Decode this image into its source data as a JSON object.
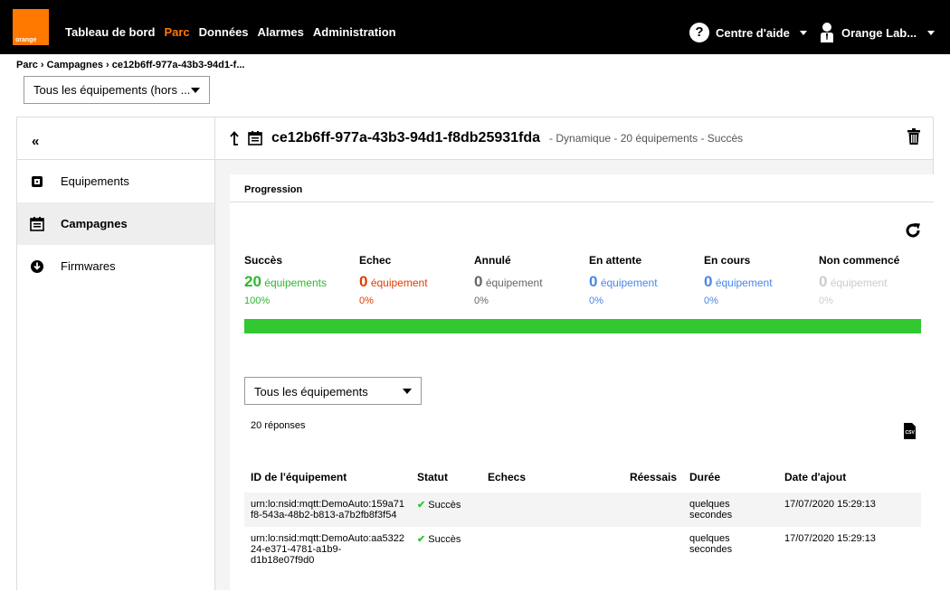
{
  "brand": {
    "logo_text": "orange",
    "color": "#ff7900"
  },
  "nav": [
    {
      "label": "Tableau de bord",
      "active": false
    },
    {
      "label": "Parc",
      "active": true
    },
    {
      "label": "Données",
      "active": false
    },
    {
      "label": "Alarmes",
      "active": false
    },
    {
      "label": "Administration",
      "active": false
    }
  ],
  "help": {
    "icon": "question-icon",
    "label": "Centre d'aide"
  },
  "user": {
    "icon": "user-icon",
    "label": "Orange Lab..."
  },
  "breadcrumb": "Parc › Campagnes › ce12b6ff-977a-43b3-94d1-f...",
  "top_select": {
    "value": "Tous les équipements (hors ..."
  },
  "sidebar": {
    "collapse": "«",
    "items": [
      {
        "label": "Equipements",
        "icon": "chip-icon",
        "active": false
      },
      {
        "label": "Campagnes",
        "icon": "calendar-icon",
        "active": true
      },
      {
        "label": "Firmwares",
        "icon": "download-icon",
        "active": false
      }
    ]
  },
  "campaign": {
    "name": "ce12b6ff-977a-43b3-94d1-f8db25931fda",
    "meta": "- Dynamique - 20 équipements - Succès"
  },
  "progress": {
    "title": "Progression",
    "fill_fraction": 1.0,
    "stats": [
      {
        "label": "Succès",
        "count": "20",
        "unit": "équipements",
        "pct": "100%",
        "color": "#2eb82e"
      },
      {
        "label": "Echec",
        "count": "0",
        "unit": "équipement",
        "pct": "0%",
        "color": "#e03c00"
      },
      {
        "label": "Annulé",
        "count": "0",
        "unit": "équipement",
        "pct": "0%",
        "color": "#666666"
      },
      {
        "label": "En attente",
        "count": "0",
        "unit": "équipement",
        "pct": "0%",
        "color": "#4a86e8"
      },
      {
        "label": "En cours",
        "count": "0",
        "unit": "équipement",
        "pct": "0%",
        "color": "#4a86e8"
      },
      {
        "label": "Non commencé",
        "count": "0",
        "unit": "équipement",
        "pct": "0%",
        "color": "#cccccc"
      }
    ]
  },
  "filter": {
    "value": "Tous les équipements"
  },
  "responses": "20 réponses",
  "table": {
    "headers": [
      "ID de l'équipement",
      "Statut",
      "Echecs",
      "Réessais",
      "Durée",
      "Date d'ajout"
    ],
    "rows": [
      {
        "id_1": "urn:lo:nsid:mqtt:DemoAuto:159a71",
        "id_2": "f8-543a-48b2-b813-a7b2fb8f3f54",
        "id_3": "",
        "status": "Succès",
        "echecs": "",
        "reessais": "",
        "duree": "quelques secondes",
        "date": "17/07/2020 15:29:13"
      },
      {
        "id_1": "urn:lo:nsid:mqtt:DemoAuto:aa5322",
        "id_2": "24-e371-4781-a1b9-",
        "id_3": "d1b18e07f9d0",
        "status": "Succès",
        "echecs": "",
        "reessais": "",
        "duree": "quelques secondes",
        "date": "17/07/2020 15:29:13"
      }
    ]
  }
}
